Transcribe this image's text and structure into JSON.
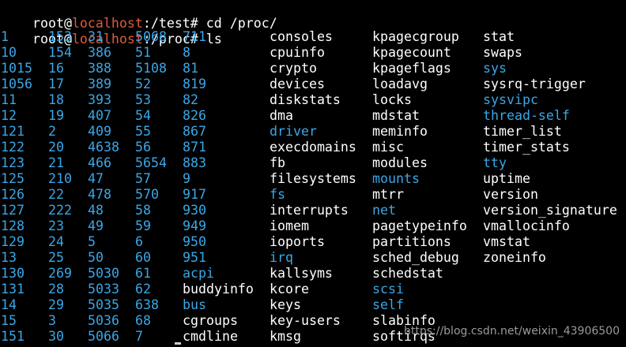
{
  "commands": [
    {
      "user": "root",
      "at": "@",
      "host": "localhost",
      "path": ":/test#",
      "cmd": " cd /proc/"
    },
    {
      "user": "root",
      "at": "@",
      "host": "localhost",
      "path": ":/proc#",
      "cmd": " ls"
    }
  ],
  "colors": {
    "background": "#000000",
    "text": "#ffffff",
    "host": "#e05a3a",
    "directory": "#3aa7e8",
    "watermark": "#9a9a9a"
  },
  "listing": {
    "col1": [
      "1",
      "10",
      "1015",
      "1056",
      "11",
      "12",
      "121",
      "122",
      "123",
      "125",
      "126",
      "127",
      "128",
      "129",
      "13",
      "130",
      "131",
      "14",
      "15",
      "151"
    ],
    "col2": [
      "153",
      "154",
      "16",
      "17",
      "18",
      "19",
      "2",
      "20",
      "21",
      "210",
      "22",
      "222",
      "23",
      "24",
      "25",
      "269",
      "28",
      "29",
      "3",
      "30"
    ],
    "col3": [
      "31",
      "386",
      "388",
      "389",
      "393",
      "407",
      "409",
      "4638",
      "466",
      "47",
      "478",
      "48",
      "49",
      "5",
      "50",
      "5030",
      "5033",
      "5035",
      "5036",
      "5066"
    ],
    "col4": [
      "5068",
      "51",
      "5108",
      "52",
      "53",
      "54",
      "55",
      "56",
      "5654",
      "57",
      "570",
      "58",
      "59",
      "6",
      "60",
      "61",
      "62",
      "638",
      "68",
      "7"
    ],
    "col5": [
      {
        "name": "711",
        "type": "dir"
      },
      {
        "name": "8",
        "type": "dir"
      },
      {
        "name": "81",
        "type": "dir"
      },
      {
        "name": "819",
        "type": "dir"
      },
      {
        "name": "82",
        "type": "dir"
      },
      {
        "name": "826",
        "type": "dir"
      },
      {
        "name": "867",
        "type": "dir"
      },
      {
        "name": "871",
        "type": "dir"
      },
      {
        "name": "883",
        "type": "dir"
      },
      {
        "name": "9",
        "type": "dir"
      },
      {
        "name": "917",
        "type": "dir"
      },
      {
        "name": "930",
        "type": "dir"
      },
      {
        "name": "949",
        "type": "dir"
      },
      {
        "name": "950",
        "type": "dir"
      },
      {
        "name": "951",
        "type": "dir"
      },
      {
        "name": "acpi",
        "type": "dir"
      },
      {
        "name": "buddyinfo",
        "type": "file"
      },
      {
        "name": "bus",
        "type": "dir"
      },
      {
        "name": "cgroups",
        "type": "file"
      },
      {
        "name": "cmdline",
        "type": "file"
      }
    ],
    "col6": [
      {
        "name": "consoles",
        "type": "file"
      },
      {
        "name": "cpuinfo",
        "type": "file"
      },
      {
        "name": "crypto",
        "type": "file"
      },
      {
        "name": "devices",
        "type": "file"
      },
      {
        "name": "diskstats",
        "type": "file"
      },
      {
        "name": "dma",
        "type": "file"
      },
      {
        "name": "driver",
        "type": "dir"
      },
      {
        "name": "execdomains",
        "type": "file"
      },
      {
        "name": "fb",
        "type": "file"
      },
      {
        "name": "filesystems",
        "type": "file"
      },
      {
        "name": "fs",
        "type": "dir"
      },
      {
        "name": "interrupts",
        "type": "file"
      },
      {
        "name": "iomem",
        "type": "file"
      },
      {
        "name": "ioports",
        "type": "file"
      },
      {
        "name": "irq",
        "type": "dir"
      },
      {
        "name": "kallsyms",
        "type": "file"
      },
      {
        "name": "kcore",
        "type": "file"
      },
      {
        "name": "keys",
        "type": "file"
      },
      {
        "name": "key-users",
        "type": "file"
      },
      {
        "name": "kmsg",
        "type": "file"
      }
    ],
    "col7": [
      {
        "name": "kpagecgroup",
        "type": "file"
      },
      {
        "name": "kpagecount",
        "type": "file"
      },
      {
        "name": "kpageflags",
        "type": "file"
      },
      {
        "name": "loadavg",
        "type": "file"
      },
      {
        "name": "locks",
        "type": "file"
      },
      {
        "name": "mdstat",
        "type": "file"
      },
      {
        "name": "meminfo",
        "type": "file"
      },
      {
        "name": "misc",
        "type": "file"
      },
      {
        "name": "modules",
        "type": "file"
      },
      {
        "name": "mounts",
        "type": "dir"
      },
      {
        "name": "mtrr",
        "type": "file"
      },
      {
        "name": "net",
        "type": "dir"
      },
      {
        "name": "pagetypeinfo",
        "type": "file"
      },
      {
        "name": "partitions",
        "type": "file"
      },
      {
        "name": "sched_debug",
        "type": "file"
      },
      {
        "name": "schedstat",
        "type": "file"
      },
      {
        "name": "scsi",
        "type": "dir"
      },
      {
        "name": "self",
        "type": "dir"
      },
      {
        "name": "slabinfo",
        "type": "file"
      },
      {
        "name": "softirqs",
        "type": "file"
      }
    ],
    "col8": [
      {
        "name": "stat",
        "type": "file"
      },
      {
        "name": "swaps",
        "type": "file"
      },
      {
        "name": "sys",
        "type": "dir"
      },
      {
        "name": "sysrq-trigger",
        "type": "file"
      },
      {
        "name": "sysvipc",
        "type": "dir"
      },
      {
        "name": "thread-self",
        "type": "dir"
      },
      {
        "name": "timer_list",
        "type": "file"
      },
      {
        "name": "timer_stats",
        "type": "file"
      },
      {
        "name": "tty",
        "type": "dir"
      },
      {
        "name": "uptime",
        "type": "file"
      },
      {
        "name": "version",
        "type": "file"
      },
      {
        "name": "version_signature",
        "type": "file"
      },
      {
        "name": "vmallocinfo",
        "type": "file"
      },
      {
        "name": "vmstat",
        "type": "file"
      },
      {
        "name": "zoneinfo",
        "type": "file"
      }
    ]
  },
  "watermark": "https://blog.csdn.net/weixin_43906500"
}
